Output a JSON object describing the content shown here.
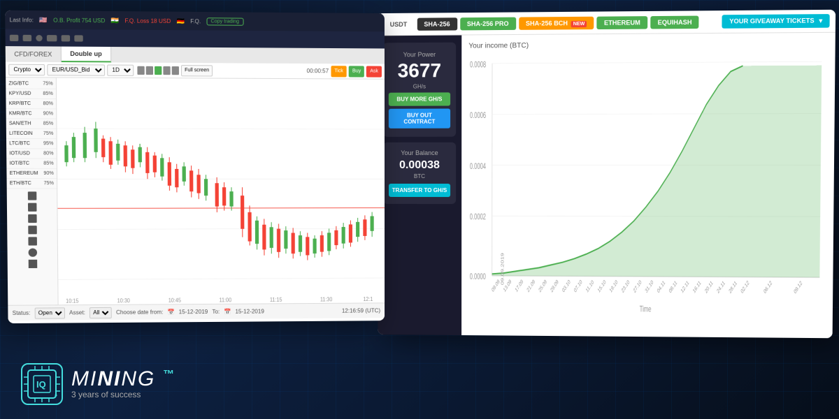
{
  "background": {
    "color_start": "#0a1628",
    "color_end": "#060e1a"
  },
  "trading_panel": {
    "topbar": {
      "last_info_label": "Last Info:",
      "trader1_flag": "🇺🇸",
      "trader1_name": "O.B.",
      "trader1_profit": "Profit 754 USD",
      "trader2_flag": "🇮🇳",
      "trader2_name": "F.Q.",
      "trader2_loss": "Loss 18 USD",
      "trader3_flag": "🇩🇪",
      "trader3_name": "F.Q.",
      "copy_btn_label": "Copy trading"
    },
    "tabs": [
      {
        "label": "CFD/FOREX",
        "active": false
      },
      {
        "label": "Double up",
        "active": true
      }
    ],
    "toolbar": {
      "dropdown1": "Crypto",
      "dropdown2": "EUR/USD_Bid",
      "dropdown3": "1D",
      "fullscreen_label": "Full screen",
      "timer": "00:00:57",
      "tick_label": "Tick",
      "buy_label": "Buy",
      "ask_label": "Ask"
    },
    "sidebar_items": [
      {
        "pair": "ZIG/BTC",
        "pct": "75%"
      },
      {
        "pair": "KPY/USD",
        "pct": "85%"
      },
      {
        "pair": "KRP/BTC",
        "pct": "80%"
      },
      {
        "pair": "KMR/BTC",
        "pct": "90%"
      },
      {
        "pair": "SAN/ETH",
        "pct": "85%"
      },
      {
        "pair": "LITECOIN",
        "pct": "75%"
      },
      {
        "pair": "LTC/BTC",
        "pct": "95%"
      },
      {
        "pair": "IOT/USD",
        "pct": "80%"
      },
      {
        "pair": "IOT/BTC",
        "pct": "85%"
      },
      {
        "pair": "ETHEREUM",
        "pct": "90%"
      },
      {
        "pair": "ETH/BTC",
        "pct": "75%"
      }
    ],
    "statusbar": {
      "status_label": "Status:",
      "status_value": "Open",
      "asset_label": "Asset:",
      "asset_value": "All",
      "date_from_label": "Choose date from:",
      "date_from": "15-12-2019",
      "date_to": "15-12-2019",
      "time": "12:16:59 (UTC)"
    }
  },
  "mining_panel": {
    "tabs": [
      {
        "label": "USDT",
        "style": "plain"
      },
      {
        "label": "SHA-256",
        "style": "dark"
      },
      {
        "label": "SHA-256 PRO",
        "style": "green"
      },
      {
        "label": "SHA-256 BCH",
        "style": "orange",
        "badge": "NEW"
      },
      {
        "label": "ETHEREUM",
        "style": "green"
      },
      {
        "label": "EQUIHASH",
        "style": "green"
      },
      {
        "label": "YOUR GIVEAWAY TICKETS",
        "style": "cyan"
      }
    ],
    "power": {
      "section_label": "Your Power",
      "value": "3677",
      "unit": "GH/s",
      "btn1": "BUY MORE GH/S",
      "btn2": "BUY OUT CONTRACT"
    },
    "balance": {
      "section_label": "Your Balance",
      "value": "0.00038",
      "unit": "BTC",
      "btn": "TRANSFER TO GH/S"
    },
    "chart": {
      "title": "Your income (BTC)",
      "y_labels": [
        "0.0008",
        "0.0006",
        "0.0004",
        "0.0002",
        "0.0000"
      ],
      "x_labels": [
        "09.09.2019",
        "13.09.2019",
        "17.09.2019",
        "21.09.2019",
        "25.09.2019",
        "29.09.2019",
        "03.10.2019",
        "07.10.2019",
        "11.10.2019",
        "15.10.2019",
        "19.10.2019",
        "23.10.2019",
        "27.10.2019",
        "31.10.2019",
        "04.11.2019",
        "08.11.2019",
        "12.11.2019",
        "16.11.2019",
        "20.11.2019",
        "24.11.2019",
        "28.11.2019",
        "02.12.2019",
        "06.12.2019",
        "09.12.2019"
      ],
      "x_axis_label": "Time",
      "area_color": "rgba(76,175,80,0.3)",
      "line_color": "#4caf50"
    }
  },
  "logo": {
    "icon_text": "IQ",
    "mining_text": "MiNING",
    "tagline": "3 years of success"
  }
}
